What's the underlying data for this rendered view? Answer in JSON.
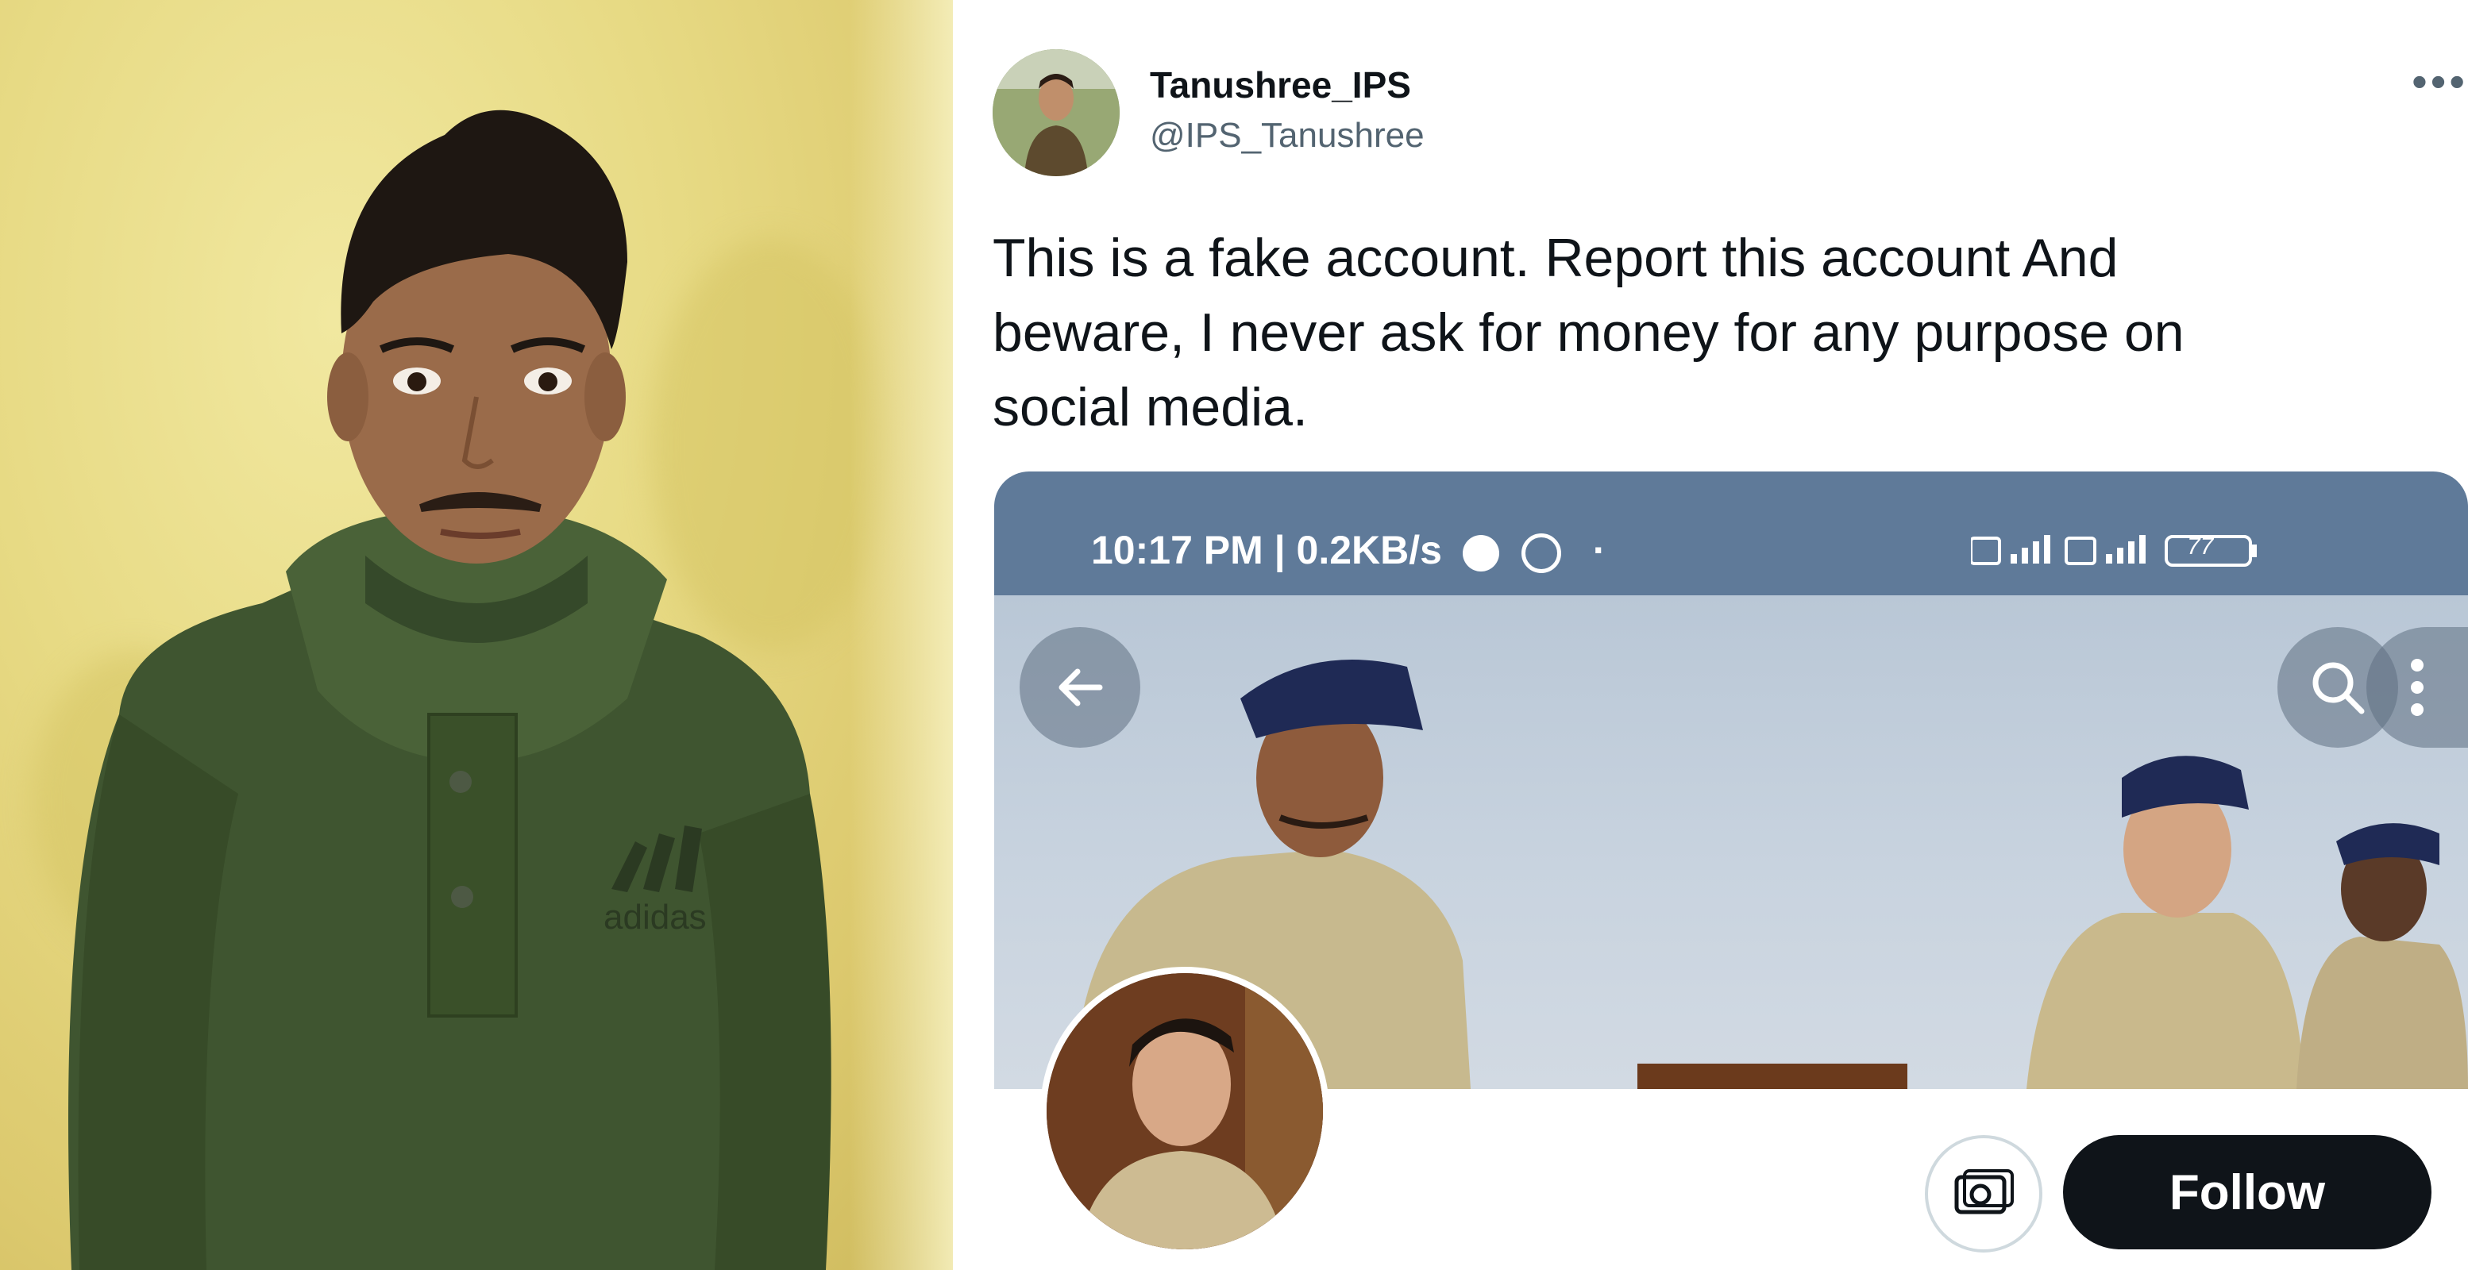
{
  "tweet": {
    "author_name": "Tanushree_IPS",
    "author_handle": "@IPS_Tanushree",
    "more_icon": "more-horizontal-icon",
    "text_line1": "This is a fake account. Report this account And",
    "text_line2": "beware, I never ask for money for any purpose on",
    "text_line3": "social media."
  },
  "embedded_screenshot": {
    "status_time": "10:17 PM | 0.2KB/s",
    "battery": "77",
    "icons": [
      "whatsapp-icon",
      "whatsapp-icon",
      "signal-icon",
      "signal-icon",
      "battery-icon"
    ],
    "back_icon": "back-arrow-icon",
    "search_icon": "search-icon",
    "menu_icon": "more-vertical-icon",
    "camera_icon": "camera-icon",
    "follow_label": "Follow"
  },
  "photo": {
    "shirt_text": "adidas"
  },
  "colors": {
    "status_bar": "#5f7a99",
    "follow_button": "#0f1419",
    "handle": "#536471"
  }
}
